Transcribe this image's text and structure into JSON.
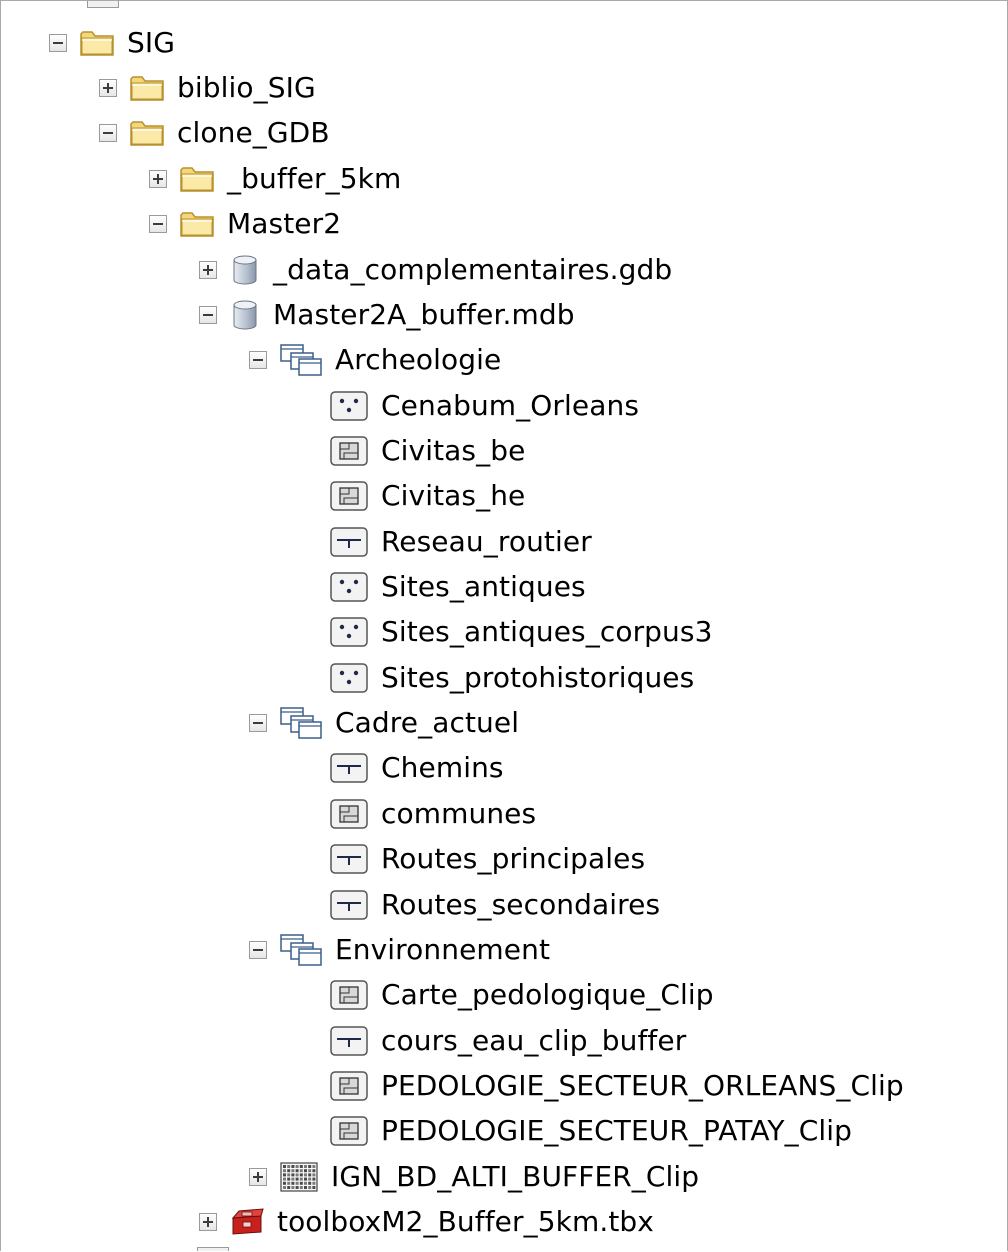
{
  "tree": {
    "nodes": [
      {
        "label": "SIG",
        "toggle": "minus",
        "icon": "folder-icon"
      },
      {
        "label": "biblio_SIG",
        "toggle": "plus",
        "icon": "folder-icon"
      },
      {
        "label": "clone_GDB",
        "toggle": "minus",
        "icon": "folder-icon"
      },
      {
        "label": "_buffer_5km",
        "toggle": "plus",
        "icon": "folder-icon"
      },
      {
        "label": "Master2",
        "toggle": "minus",
        "icon": "folder-icon"
      },
      {
        "label": "_data_complementaires.gdb",
        "toggle": "plus",
        "icon": "geodatabase-icon"
      },
      {
        "label": "Master2A_buffer.mdb",
        "toggle": "minus",
        "icon": "geodatabase-icon"
      },
      {
        "label": "Archeologie",
        "toggle": "minus",
        "icon": "feature-dataset-icon"
      },
      {
        "label": "Cenabum_Orleans",
        "toggle": "none",
        "icon": "point-feature-class-icon"
      },
      {
        "label": "Civitas_be",
        "toggle": "none",
        "icon": "polygon-feature-class-icon"
      },
      {
        "label": "Civitas_he",
        "toggle": "none",
        "icon": "polygon-feature-class-icon"
      },
      {
        "label": "Reseau_routier",
        "toggle": "none",
        "icon": "line-feature-class-icon"
      },
      {
        "label": "Sites_antiques",
        "toggle": "none",
        "icon": "point-feature-class-icon"
      },
      {
        "label": "Sites_antiques_corpus3",
        "toggle": "none",
        "icon": "point-feature-class-icon"
      },
      {
        "label": "Sites_protohistoriques",
        "toggle": "none",
        "icon": "point-feature-class-icon"
      },
      {
        "label": "Cadre_actuel",
        "toggle": "minus",
        "icon": "feature-dataset-icon"
      },
      {
        "label": "Chemins",
        "toggle": "none",
        "icon": "line-feature-class-icon"
      },
      {
        "label": "communes",
        "toggle": "none",
        "icon": "polygon-feature-class-icon"
      },
      {
        "label": "Routes_principales",
        "toggle": "none",
        "icon": "line-feature-class-icon"
      },
      {
        "label": "Routes_secondaires",
        "toggle": "none",
        "icon": "line-feature-class-icon"
      },
      {
        "label": "Environnement",
        "toggle": "minus",
        "icon": "feature-dataset-icon"
      },
      {
        "label": "Carte_pedologique_Clip",
        "toggle": "none",
        "icon": "polygon-feature-class-icon"
      },
      {
        "label": "cours_eau_clip_buffer",
        "toggle": "none",
        "icon": "line-feature-class-icon"
      },
      {
        "label": "PEDOLOGIE_SECTEUR_ORLEANS_Clip",
        "toggle": "none",
        "icon": "polygon-feature-class-icon"
      },
      {
        "label": "PEDOLOGIE_SECTEUR_PATAY_Clip",
        "toggle": "none",
        "icon": "polygon-feature-class-icon"
      },
      {
        "label": "IGN_BD_ALTI_BUFFER_Clip",
        "toggle": "plus",
        "icon": "raster-dataset-icon"
      },
      {
        "label": "toolboxM2_Buffer_5km.tbx",
        "toggle": "plus",
        "icon": "toolbox-icon"
      }
    ]
  },
  "colors": {
    "folder": "#f3d77a",
    "folder_edge": "#b8912e",
    "database": "#8a96a8",
    "toolbox": "#c8201c",
    "text": "#000000"
  }
}
